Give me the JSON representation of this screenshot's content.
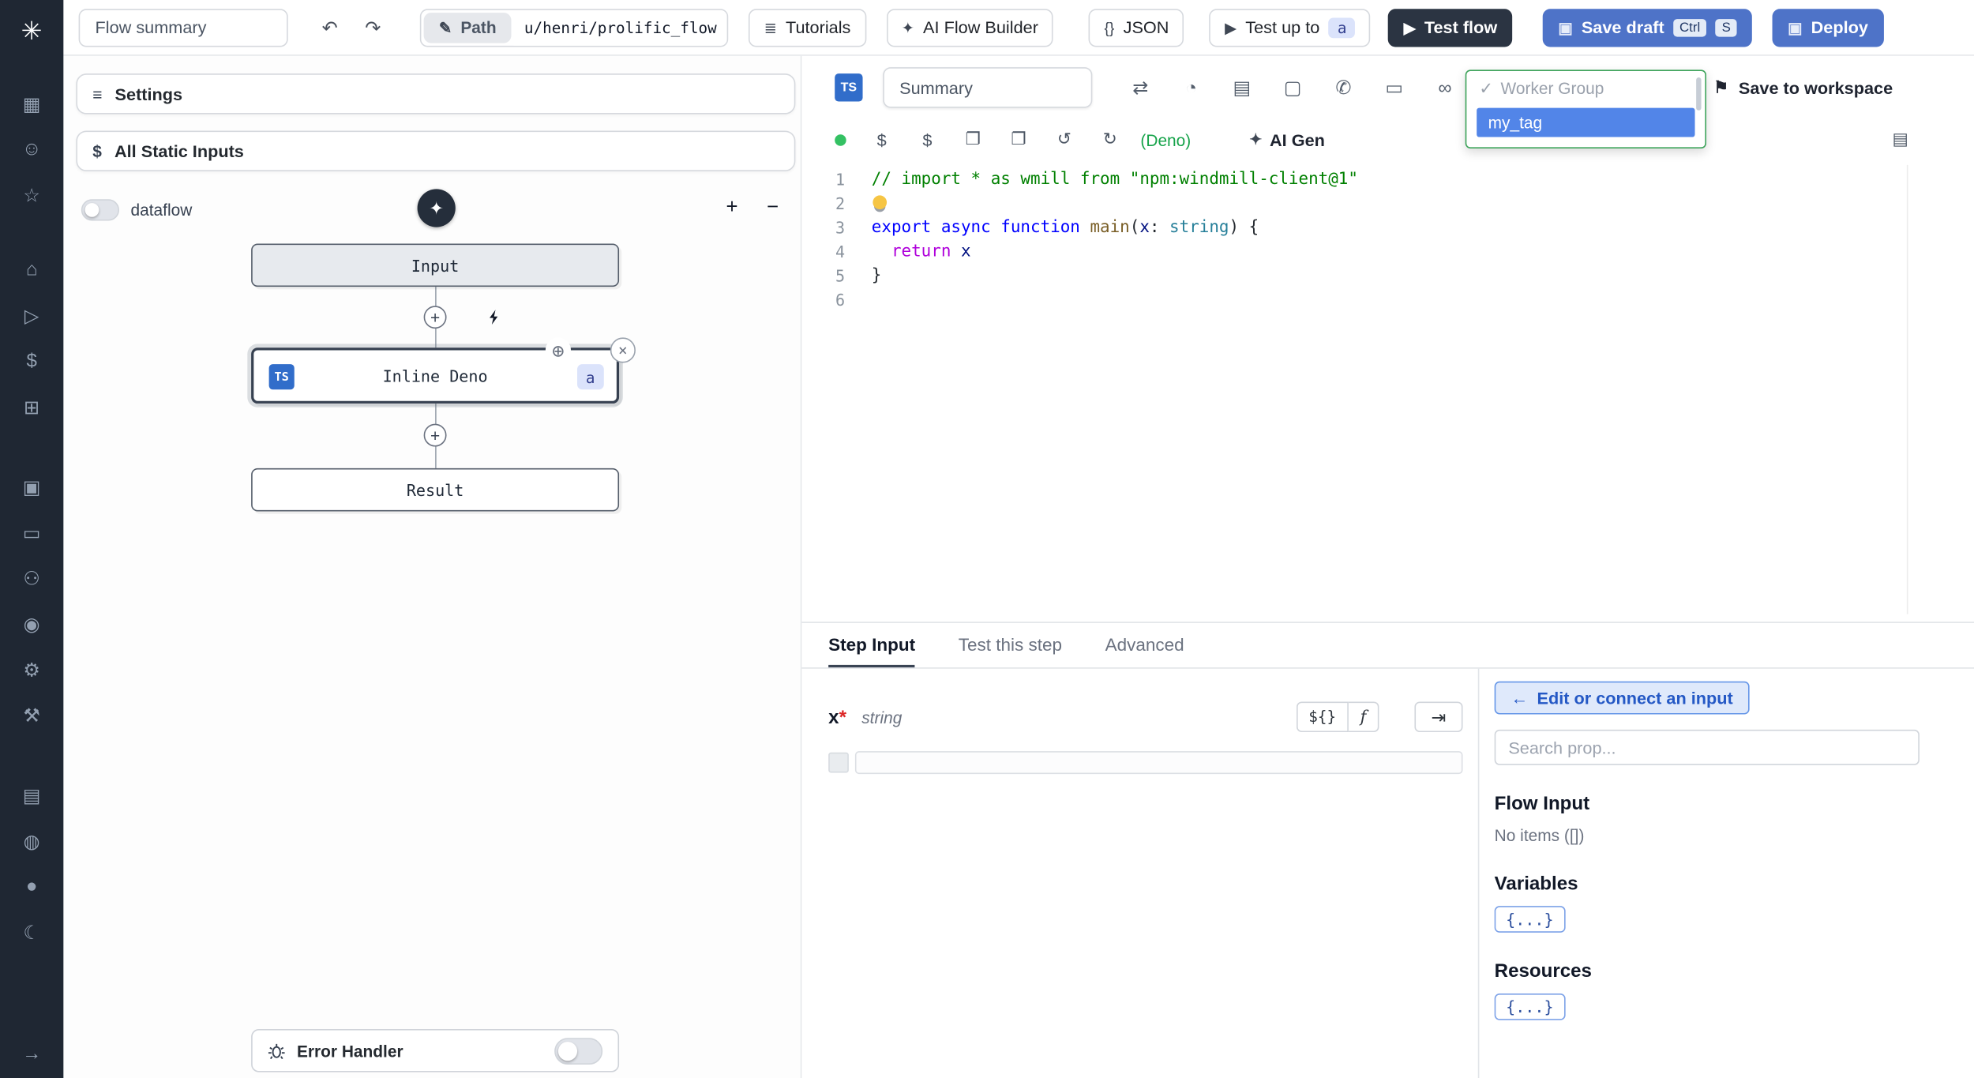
{
  "icons": {
    "undo": "↶",
    "redo": "↷",
    "pencil": "✎",
    "book": "≣",
    "sparkle": "✦",
    "json": "{}",
    "play": "▶",
    "save": "▣",
    "deploy": "▣",
    "kbd_plus": "+",
    "minus": "−",
    "settings_sliders": "≡",
    "dollar": "$",
    "wand": "✦",
    "plus": "+",
    "crosshair": "⊕",
    "close": "×",
    "bookmark": "⚑",
    "arrow_left": "←",
    "plug": "⇥",
    "swap": "⇄",
    "gauge": "◔",
    "cache": "▤",
    "checkbox": "▢",
    "phone": "✆",
    "sleep": "▭",
    "link": "∞",
    "copy": "❐",
    "clipboard": "❐",
    "undo2": "↺",
    "redo2": "↻",
    "library": "▤",
    "check": "✓"
  },
  "sidebar": {
    "items": [
      {
        "name": "windmill-logo",
        "glyph": "✳"
      },
      {
        "name": "apps-icon",
        "glyph": "▦"
      },
      {
        "name": "user-icon",
        "glyph": "☺"
      },
      {
        "name": "favorites-icon",
        "glyph": "☆"
      },
      {
        "name": "home-icon",
        "glyph": "⌂"
      },
      {
        "name": "runs-icon",
        "glyph": "▷"
      },
      {
        "name": "variables-icon",
        "glyph": "$"
      },
      {
        "name": "resources-icon",
        "glyph": "⊞"
      },
      {
        "name": "schedules-icon",
        "glyph": "▣"
      },
      {
        "name": "folders-icon",
        "glyph": "▭"
      },
      {
        "name": "groups-icon",
        "glyph": "⚇"
      },
      {
        "name": "audit-logs-icon",
        "glyph": "◉"
      },
      {
        "name": "settings-icon",
        "glyph": "⚙"
      },
      {
        "name": "workers-icon",
        "glyph": "⚒"
      },
      {
        "name": "docs-icon",
        "glyph": "▤"
      },
      {
        "name": "discord-icon",
        "glyph": "◍"
      },
      {
        "name": "github-icon",
        "glyph": "●"
      },
      {
        "name": "dark-mode-icon",
        "glyph": "☾"
      },
      {
        "name": "expand-sidebar-icon",
        "glyph": "→"
      }
    ]
  },
  "topbar": {
    "flow_summary_placeholder": "Flow summary",
    "path_label": "Path",
    "path_value": "u/henri/prolific_flow",
    "tutorials": "Tutorials",
    "ai_flow_builder": "AI Flow Builder",
    "json_label": "JSON",
    "test_up_to": "Test up to",
    "test_up_to_badge": "a",
    "test_flow": "Test flow",
    "save_draft": "Save draft",
    "kbd_ctrl": "Ctrl",
    "kbd_s": "S",
    "deploy": "Deploy"
  },
  "flow": {
    "settings_label": "Settings",
    "static_inputs_label": "All Static Inputs",
    "dataflow_label": "dataflow",
    "input_node": "Input",
    "deno_node": {
      "lang": "TS",
      "title": "Inline Deno",
      "badge": "a"
    },
    "result_node": "Result",
    "error_handler_label": "Error Handler"
  },
  "editor": {
    "lang_badge": "TS",
    "summary_placeholder": "Summary",
    "save_to_workspace": "Save to workspace",
    "dropdown": {
      "check": "✓",
      "group": "Worker Group",
      "selected": "my_tag"
    },
    "deno_hint": "(Deno)",
    "ai_gen": "AI Gen",
    "gutter": [
      "1",
      "2",
      "3",
      "4",
      "5",
      "6"
    ],
    "code": [
      {
        "tokens": [
          {
            "t": "// import * as wmill from \"npm:windmill-client@1\"",
            "c": "comment"
          }
        ]
      },
      {
        "bulb": true,
        "tokens": []
      },
      {
        "tokens": [
          {
            "t": "export async function ",
            "c": "kw"
          },
          {
            "t": "main",
            "c": "fn"
          },
          {
            "t": "(",
            "c": "pl"
          },
          {
            "t": "x",
            "c": "param"
          },
          {
            "t": ": ",
            "c": "pl"
          },
          {
            "t": "string",
            "c": "type"
          },
          {
            "t": ") {",
            "c": "pl"
          }
        ]
      },
      {
        "tokens": [
          {
            "t": "  ",
            "c": "pl"
          },
          {
            "t": "return",
            "c": "ctrl"
          },
          {
            "t": " ",
            "c": "pl"
          },
          {
            "t": "x",
            "c": "param"
          }
        ]
      },
      {
        "tokens": [
          {
            "t": "}",
            "c": "pl"
          }
        ]
      },
      {
        "tokens": []
      }
    ]
  },
  "step": {
    "tabs": [
      "Step Input",
      "Test this step",
      "Advanced"
    ],
    "arg": {
      "name": "x",
      "required": "*",
      "type": "string"
    },
    "expr_btn": "${}",
    "fx_btn": "f",
    "connect_btn": "Edit or connect an input",
    "search_placeholder": "Search prop...",
    "flow_input_title": "Flow Input",
    "flow_input_empty": "No items ([])",
    "variables_title": "Variables",
    "variables_chip": "{...}",
    "resources_title": "Resources",
    "resources_chip": "{...}"
  },
  "colors": {
    "accent_blue": "#4e73c8",
    "dark_button": "#2b3442",
    "selection_blue": "#5285e8",
    "dropdown_border_green": "#3da35a",
    "status_green": "#34c163"
  }
}
